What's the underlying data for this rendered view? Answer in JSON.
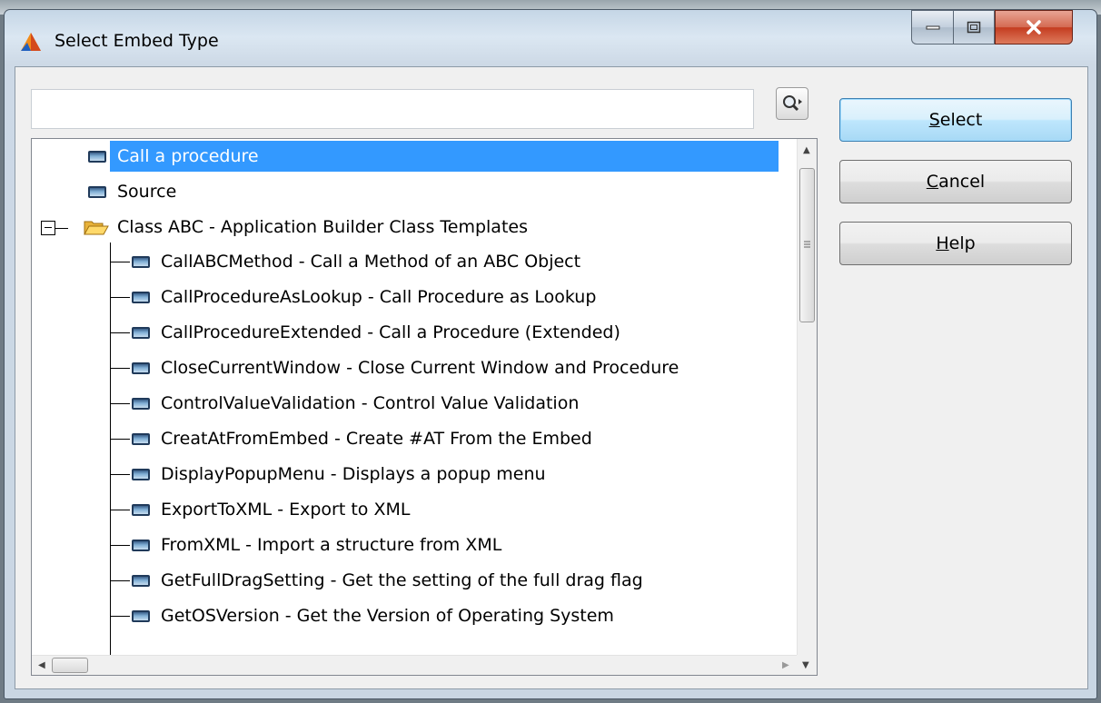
{
  "window": {
    "title": "Select Embed Type"
  },
  "search": {
    "value": "",
    "placeholder": ""
  },
  "tree": {
    "items": [
      {
        "label": "Call a procedure",
        "selected": true
      },
      {
        "label": "Source"
      },
      {
        "label": "Class ABC - Application Builder Class Templates",
        "expanded": true
      },
      {
        "label": "CallABCMethod - Call a Method of an ABC Object"
      },
      {
        "label": "CallProcedureAsLookup - Call Procedure as Lookup"
      },
      {
        "label": "CallProcedureExtended - Call a Procedure (Extended)"
      },
      {
        "label": "CloseCurrentWindow - Close Current Window and Procedure"
      },
      {
        "label": "ControlValueValidation - Control Value Validation"
      },
      {
        "label": "CreatAtFromEmbed - Create #AT From the Embed"
      },
      {
        "label": "DisplayPopupMenu - Displays a popup menu"
      },
      {
        "label": "ExportToXML - Export to XML"
      },
      {
        "label": "FromXML - Import a structure from XML"
      },
      {
        "label": "GetFullDragSetting - Get the setting of the full drag flag"
      },
      {
        "label": "GetOSVersion - Get the Version of Operating System"
      }
    ]
  },
  "buttons": {
    "select": {
      "mnemonic": "S",
      "rest": "elect"
    },
    "cancel": {
      "mnemonic": "C",
      "rest": "ancel"
    },
    "help": {
      "mnemonic": "H",
      "rest": "elp"
    }
  },
  "colors": {
    "selection": "#3399ff",
    "close_button": "#c43c20"
  }
}
